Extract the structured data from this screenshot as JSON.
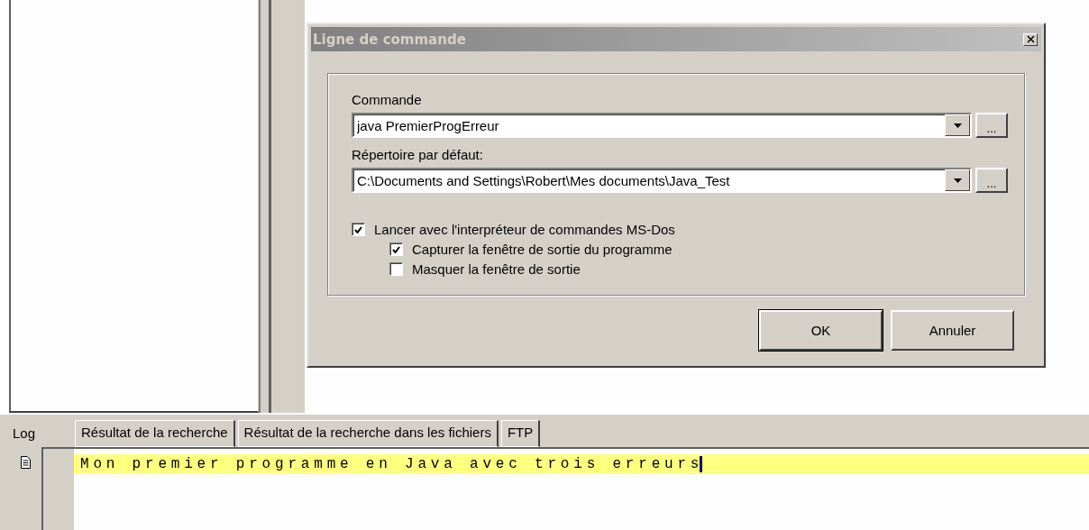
{
  "dialog": {
    "title": "Ligne de commande",
    "fields": [
      {
        "label": "Commande",
        "value": "java PremierProgErreur",
        "browse": "..."
      },
      {
        "label": "Répertoire par défaut:",
        "value": "C:\\Documents and Settings\\Robert\\Mes documents\\Java_Test",
        "browse": "..."
      }
    ],
    "options": [
      {
        "label": "Lancer avec l'interpréteur de commandes MS-Dos",
        "checked": true,
        "children": [
          {
            "label": "Capturer la fenêtre de sortie du programme",
            "checked": true
          },
          {
            "label": "Masquer la fenêtre de sortie",
            "checked": false
          }
        ]
      }
    ],
    "buttons": [
      {
        "label": "OK",
        "default": true
      },
      {
        "label": "Annuler",
        "default": false
      }
    ]
  },
  "tabs": [
    {
      "label": "Log",
      "selected": true
    },
    {
      "label": "Résultat de la recherche",
      "selected": false
    },
    {
      "label": "Résultat de la recherche dans les fichiers",
      "selected": false
    },
    {
      "label": "FTP",
      "selected": false
    }
  ],
  "log": {
    "lines": [
      {
        "text": "Mon premier programme en Java avec trois erreurs",
        "highlighted": true
      }
    ]
  }
}
